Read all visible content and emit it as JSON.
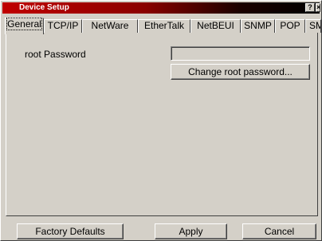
{
  "window": {
    "title": "Device Setup",
    "help_glyph": "?",
    "close_glyph": "×"
  },
  "tabs": [
    {
      "label": "General",
      "active": true
    },
    {
      "label": "TCP/IP",
      "active": false
    },
    {
      "label": "NetWare",
      "active": false
    },
    {
      "label": "EtherTalk",
      "active": false
    },
    {
      "label": "NetBEUI",
      "active": false
    },
    {
      "label": "SNMP",
      "active": false
    },
    {
      "label": "POP",
      "active": false
    },
    {
      "label": "SMTP",
      "active": false
    }
  ],
  "general": {
    "root_password_label": "root Password",
    "root_password_value": "",
    "change_password_button": "Change root password..."
  },
  "footer": {
    "factory_defaults": "Factory Defaults",
    "apply": "Apply",
    "cancel": "Cancel"
  }
}
